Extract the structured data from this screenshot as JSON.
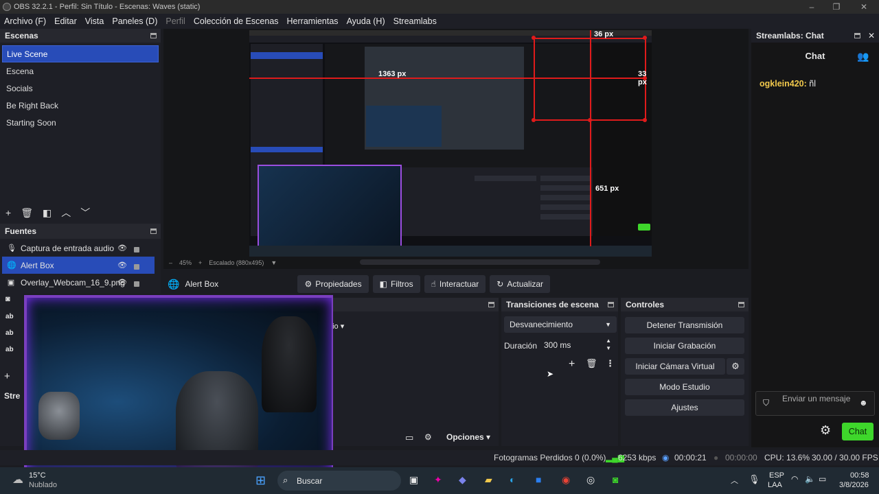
{
  "window": {
    "title": "OBS 32.2.1 - Perfil: Sin Título - Escenas: Waves (static)"
  },
  "menu": [
    "Archivo (F)",
    "Editar",
    "Vista",
    "Paneles (D)",
    "Perfil",
    "Colección de Escenas",
    "Herramientas",
    "Ayuda (H)",
    "Streamlabs"
  ],
  "scenes": {
    "title": "Escenas",
    "items": [
      "Live Scene",
      "Escena",
      "Socials",
      "Be Right Back",
      "Starting Soon"
    ]
  },
  "sources": {
    "title": "Fuentes",
    "items": [
      "Captura de entrada audio",
      "Alert Box",
      "Overlay_Webcam_16_9.png"
    ]
  },
  "partial_title": "Stre",
  "preview": {
    "zoom": "45%",
    "scaling": "Escalado (880x495)",
    "measure_top": "36 px",
    "measure_left": "1363 px",
    "measure_right": "33 px",
    "measure_bottom": "651 px"
  },
  "source_toolbar": {
    "selected": "Alert Box",
    "props": "Propiedades",
    "filters": "Filtros",
    "interact": "Interactuar",
    "refresh": "Actualizar"
  },
  "mixer": {
    "dropdown_frag": "dio",
    "options": "Opciones"
  },
  "transitions": {
    "title": "Transiciones de escena",
    "type": "Desvanecimiento",
    "duration_label": "Duración",
    "duration_value": "300 ms"
  },
  "controls": {
    "title": "Controles",
    "buttons": [
      "Detener Transmisión",
      "Iniciar Grabación",
      "Iniciar Cámara Virtual",
      "Modo Estudio",
      "Ajustes"
    ]
  },
  "chat": {
    "dock_title": "Streamlabs: Chat",
    "header": "Chat",
    "message_user": "ogklein420:",
    "message_text": "ñl",
    "input_placeholder": "Enviar un mensaje",
    "send": "Chat"
  },
  "status": {
    "dropped": "Fotogramas Perdidos 0 (0.0%)",
    "bitrate": "6253 kbps",
    "stream_time": "00:00:21",
    "rec_time": "00:00:00",
    "cpu": "CPU: 13.6%",
    "fps": "30.00 / 30.00 FPS"
  },
  "taskbar": {
    "temp": "15°C",
    "weather": "Nublado",
    "search": "Buscar",
    "lang1": "ESP",
    "lang2": "LAA",
    "time": "00:58",
    "date": "3/8/2026"
  },
  "colors": {
    "accent": "#284cb8",
    "chat_green": "#3ed62b",
    "measure_red": "#e01b1b",
    "username": "#f2c94c"
  }
}
